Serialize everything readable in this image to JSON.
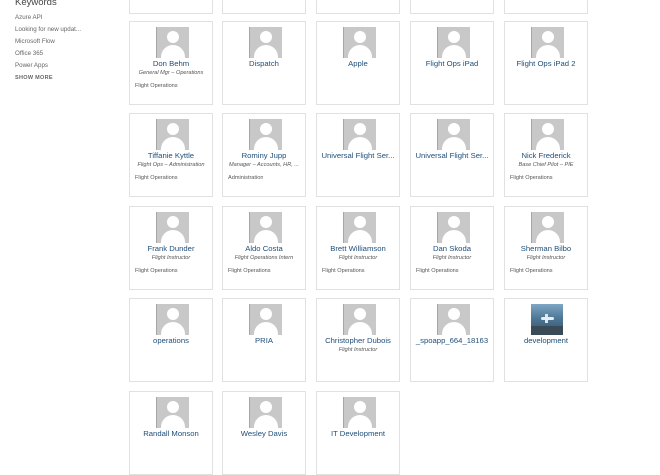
{
  "sidebar": {
    "title": "Keywords",
    "items": [
      "Azure API",
      "Looking for new updat...",
      "Microsoft Flow",
      "Office 365",
      "Power Apps"
    ],
    "show_more": "SHOW MORE"
  },
  "people": [
    {
      "name": "",
      "title": "",
      "department": "",
      "icon": "person-placeholder-icon"
    },
    {
      "name": "",
      "title": "",
      "department": "",
      "icon": "person-placeholder-icon"
    },
    {
      "name": "",
      "title": "",
      "department": "",
      "icon": "person-placeholder-icon"
    },
    {
      "name": "",
      "title": "",
      "department": "",
      "icon": "person-placeholder-icon"
    },
    {
      "name": "",
      "title": "",
      "department": "",
      "icon": "person-placeholder-icon"
    },
    {
      "name": "Don Behm",
      "title": "General Mgr – Operations",
      "department": "Flight Operations",
      "icon": "person-placeholder-icon"
    },
    {
      "name": "Dispatch",
      "title": "",
      "department": "",
      "icon": "person-placeholder-icon"
    },
    {
      "name": "Apple",
      "title": "",
      "department": "",
      "icon": "person-placeholder-icon"
    },
    {
      "name": "Flight Ops iPad",
      "title": "",
      "department": "",
      "icon": "person-placeholder-icon"
    },
    {
      "name": "Flight Ops iPad 2",
      "title": "",
      "department": "",
      "icon": "person-placeholder-icon"
    },
    {
      "name": "Tiffanie Kyttle",
      "title": "Flight Ops – Administration",
      "department": "Flight Operations",
      "icon": "person-placeholder-icon"
    },
    {
      "name": "Rominy Jupp",
      "title": "Manager – Accounts, HR, ...",
      "department": "Administration",
      "icon": "person-placeholder-icon"
    },
    {
      "name": "Universal Flight Ser...",
      "title": "",
      "department": "",
      "icon": "person-placeholder-icon"
    },
    {
      "name": "Universal Flight Ser...",
      "title": "",
      "department": "",
      "icon": "person-placeholder-icon"
    },
    {
      "name": "Nick Frederick",
      "title": "Base Chief Pilot – PIE",
      "department": "Flight Operations",
      "icon": "person-placeholder-icon"
    },
    {
      "name": "Frank Dunder",
      "title": "Flight Instructor",
      "department": "Flight Operations",
      "icon": "person-placeholder-icon"
    },
    {
      "name": "Aldo Costa",
      "title": "Flight Operations Intern",
      "department": "Flight Operations",
      "icon": "person-placeholder-icon"
    },
    {
      "name": "Brett Williamson",
      "title": "Flight Instructor",
      "department": "Flight Operations",
      "icon": "person-placeholder-icon"
    },
    {
      "name": "Dan Skoda",
      "title": "Flight Instructor",
      "department": "Flight Operations",
      "icon": "person-placeholder-icon"
    },
    {
      "name": "Sherman Bilbo",
      "title": "Flight Instructor",
      "department": "Flight Operations",
      "icon": "person-placeholder-icon"
    },
    {
      "name": "operations",
      "title": "",
      "department": "",
      "icon": "person-placeholder-icon"
    },
    {
      "name": "PRIA",
      "title": "",
      "department": "",
      "icon": "person-placeholder-icon"
    },
    {
      "name": "Christopher Dubois",
      "title": "Flight Instructor",
      "department": "",
      "icon": "person-placeholder-icon"
    },
    {
      "name": "_spoapp_664_18163",
      "title": "",
      "department": "",
      "icon": "person-placeholder-icon"
    },
    {
      "name": "development",
      "title": "",
      "department": "",
      "icon": "aircraft-photo"
    },
    {
      "name": "Randall Monson",
      "title": "",
      "department": "",
      "icon": "person-placeholder-icon"
    },
    {
      "name": "Wesley Davis",
      "title": "",
      "department": "",
      "icon": "person-placeholder-icon"
    },
    {
      "name": "IT Development",
      "title": "",
      "department": "",
      "icon": "person-placeholder-icon"
    }
  ]
}
